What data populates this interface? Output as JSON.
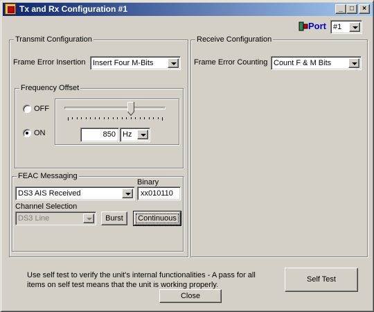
{
  "window": {
    "title": "Tx and Rx Configuration #1",
    "buttons": {
      "minimize": "_",
      "maximize": "□",
      "close": "×"
    }
  },
  "port": {
    "label": "Port",
    "value": "#1"
  },
  "transmit": {
    "group_label": "Transmit Configuration",
    "frame_error_label": "Frame Error Insertion",
    "frame_error_value": "Insert Four M-Bits",
    "frequency": {
      "group_label": "Frequency Offset",
      "off_label": "OFF",
      "on_label": "ON",
      "selected": "ON",
      "value": "850",
      "unit": "Hz",
      "slider_level": 0.67
    },
    "feac": {
      "group_label": "FEAC Messaging",
      "message_value": "DS3 AIS Received",
      "binary_label": "Binary",
      "binary_value": "xx010110",
      "channel_label": "Channel Selection",
      "channel_value": "DS3 Line",
      "burst_label": "Burst",
      "continuous_label": "Continuous"
    }
  },
  "receive": {
    "group_label": "Receive Configuration",
    "frame_error_label": "Frame Error Counting",
    "frame_error_value": "Count F & M Bits"
  },
  "footer": {
    "info_text": "Use self test to verify the unit's internal functionalities - A pass for all items on self test means that the unit is working properly.",
    "self_test_label": "Self Test",
    "close_label": "Close"
  }
}
